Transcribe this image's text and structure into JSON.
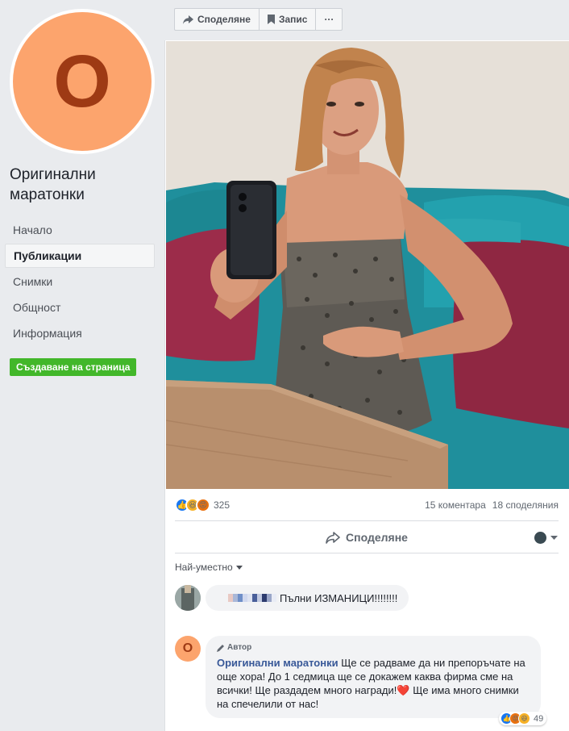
{
  "page": {
    "avatar_letter": "O",
    "name": "Оригинални маратонки"
  },
  "nav": {
    "items": [
      "Начало",
      "Публикации",
      "Снимки",
      "Общност",
      "Информация"
    ],
    "active_index": 1
  },
  "create_page_button": "Създаване на страница",
  "toolbar": {
    "share_label": "Споделяне",
    "save_label": "Запис",
    "more_label": "···"
  },
  "post": {
    "photo_description_icon": "photo-of-woman-holding-phone",
    "reactions_count": "325",
    "comments_count": "15 коментара",
    "shares_count": "18 споделяния",
    "share_action": "Споделяне"
  },
  "comments": {
    "sort_label": "Най-уместно",
    "items": [
      {
        "text": "Пълни ИЗМАНИЦИ!!!!!!!!"
      },
      {
        "author_tag": "Автор",
        "author": "Оригинални маратонки",
        "text": " Ще се радваме да ни препоръчате на още хора! До 1 седмица ще се докажем каква фирма сме на всички! Ще раздадем много награди!",
        "heart": "❤️",
        "text_after": " Ще има много снимки на спечелили от нас!",
        "reactions_count": "49"
      }
    ]
  },
  "colors": {
    "accent": "#385898",
    "create_button": "#42b72a",
    "avatar_bg": "#fca46d",
    "avatar_letter": "#9e3a14"
  }
}
